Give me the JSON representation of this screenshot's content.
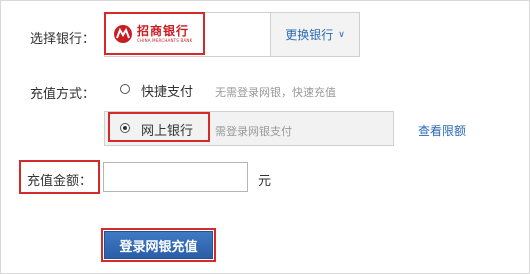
{
  "bank_select": {
    "label": "选择银行：",
    "bank_name_cn": "招商银行",
    "bank_name_en": "CHINA MERCHANTS BANK",
    "switch_label": "更换银行"
  },
  "payment_method": {
    "label": "充值方式：",
    "options": [
      {
        "label": "快捷支付",
        "hint": "无需登录网银，快速充值",
        "selected": false
      },
      {
        "label": "网上银行",
        "hint": "需登录网银支付",
        "selected": true
      }
    ],
    "limit_link": "查看限额"
  },
  "amount": {
    "label": "充值金额：",
    "value": "",
    "unit": "元"
  },
  "submit": {
    "label": "登录网银充值"
  },
  "colors": {
    "highlight": "#d42a2a",
    "link": "#2a6ab4",
    "brand": "#c81d23",
    "button": "#2a5ea7"
  }
}
